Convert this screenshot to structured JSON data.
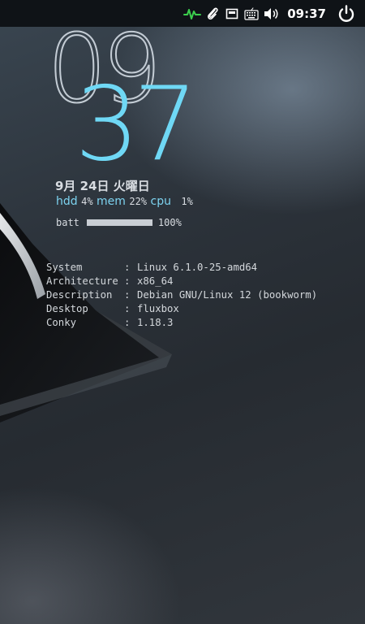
{
  "panel": {
    "clock": "09:37",
    "icons": [
      "activity-monitor-icon",
      "paperclip-icon",
      "network-icon",
      "keyboard-icon",
      "volume-icon",
      "power-icon"
    ],
    "activity_color": "#3ccf4e"
  },
  "conky": {
    "hour": "09",
    "minute": "37",
    "date": "9月 24日 火曜日",
    "hdd_label": "hdd",
    "hdd_value": "4%",
    "mem_label": "mem",
    "mem_value": "22%",
    "cpu_label": "cpu",
    "cpu_value": "1%",
    "batt_label": "batt",
    "batt_value": "100%",
    "batt_fraction": 1.0,
    "accent_color": "#6fd8f5",
    "system_info": [
      {
        "key": "System",
        "value": "Linux 6.1.0-25-amd64"
      },
      {
        "key": "Architecture",
        "value": "x86_64"
      },
      {
        "key": "Description",
        "value": "Debian GNU/Linux 12 (bookworm)"
      },
      {
        "key": "Desktop",
        "value": "fluxbox"
      },
      {
        "key": "Conky",
        "value": "1.18.3"
      }
    ],
    "separator": ":"
  }
}
